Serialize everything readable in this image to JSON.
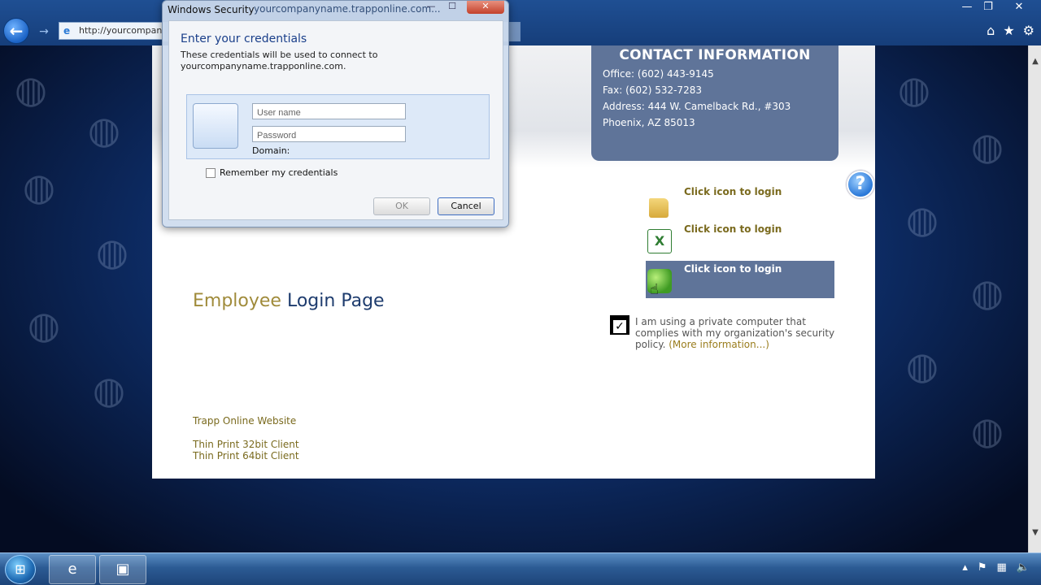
{
  "browser": {
    "address_url": "http://yourcompan",
    "back_icon": "back-arrow-icon",
    "forward_icon": "forward-arrow-icon",
    "window_controls": [
      "—",
      "❐",
      "✕"
    ],
    "toolbar_icons": [
      "home-icon",
      "favorites-star-icon",
      "gear-icon"
    ]
  },
  "dialog": {
    "title": "Windows Security",
    "title_url": "yourcompanyname.trapponline.com...",
    "heading": "Enter your credentials",
    "desc_line1": "These credentials will be used to connect to",
    "desc_line2": "yourcompanyname.trapponline.com.",
    "username_placeholder": "User name",
    "password_placeholder": "Password",
    "domain_label": "Domain:",
    "remember_label": "Remember my credentials",
    "ok_label": "OK",
    "cancel_label": "Cancel"
  },
  "contact": {
    "title": "CONTACT INFORMATION",
    "office": "Office: (602) 443-9145",
    "fax": "Fax: (602) 532-7283",
    "address": "Address: 444 W. Camelback Rd., #303",
    "city": "Phoenix, AZ 85013"
  },
  "login_items": [
    {
      "label": "Click icon to login",
      "icon": "folder-icon"
    },
    {
      "label": "Click icon to login",
      "icon": "excel-icon"
    },
    {
      "label": "Click icon to login",
      "icon": "green-app-icon"
    }
  ],
  "policy": {
    "text": "I am using a private computer that complies with my organization's security policy. ",
    "link": "(More information...)"
  },
  "page_title": {
    "part1": "Employee",
    "part2": "Login Page"
  },
  "footer_links": [
    "Trapp Online Website",
    "Thin Print 32bit Client",
    "Thin Print 64bit Client"
  ],
  "taskbar": {
    "tray_icons": [
      "tray-up-arrow-icon",
      "action-center-flag-icon",
      "network-icon",
      "volume-icon"
    ]
  },
  "colors": {
    "contact_panel": "#5f7499",
    "gold_text": "#7a6a1e",
    "title_blue": "#1e3c6e"
  }
}
